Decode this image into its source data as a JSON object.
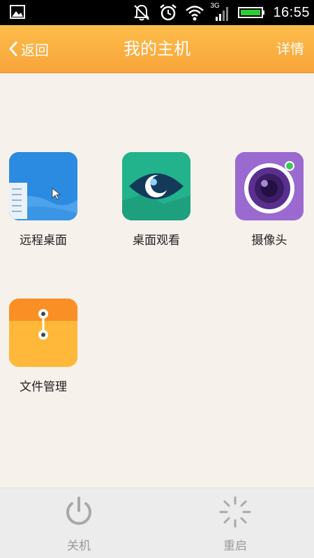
{
  "status_bar": {
    "time": "16:55",
    "network_label": "3G",
    "icons": [
      "gallery-icon",
      "bell-off-icon",
      "alarm-icon",
      "wifi-icon",
      "cell-signal-icon",
      "battery-icon"
    ],
    "battery_color": "#2fcc2f"
  },
  "header": {
    "back_label": "返回",
    "title": "我的主机",
    "detail_label": "详情",
    "bg_color": "#f9ab3d"
  },
  "apps": [
    {
      "label": "远程桌面",
      "icon": "remote-desktop-icon"
    },
    {
      "label": "桌面观看",
      "icon": "eye-icon"
    },
    {
      "label": "摄像头",
      "icon": "camera-icon"
    },
    {
      "label": "文件管理",
      "icon": "file-folder-icon"
    }
  ],
  "bottom_bar": {
    "shutdown_label": "关机",
    "restart_label": "重启",
    "icons": [
      "power-icon",
      "loading-spinner-icon"
    ]
  }
}
